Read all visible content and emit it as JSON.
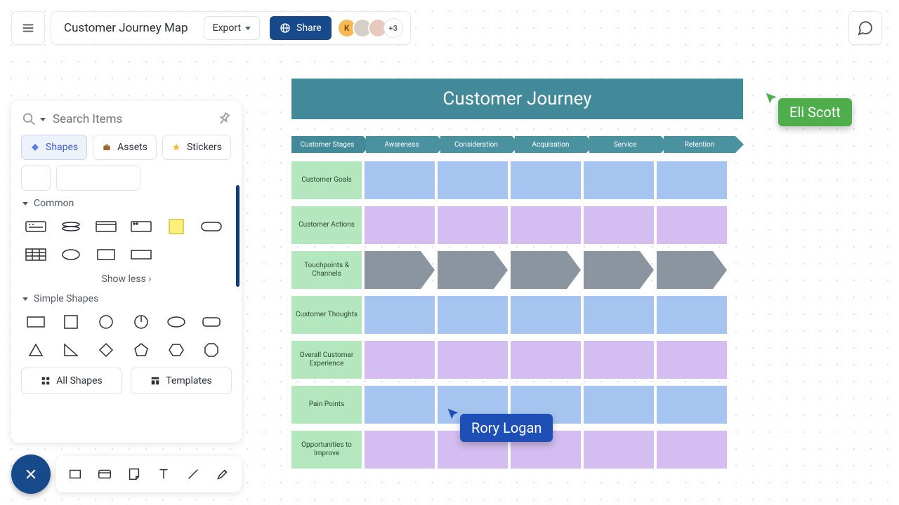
{
  "toolbar": {
    "doc_title": "Customer Journey Map",
    "export_label": "Export",
    "share_label": "Share",
    "avatar_more": "+3"
  },
  "panel": {
    "search_placeholder": "Search Items",
    "tabs": [
      "Shapes",
      "Assets",
      "Stickers"
    ],
    "section_common": "Common",
    "section_simple": "Simple Shapes",
    "show_less": "Show less",
    "all_shapes": "All Shapes",
    "templates": "Templates"
  },
  "canvas": {
    "title": "Customer Journey",
    "stages": [
      "Customer Stages",
      "Awareness",
      "Consideration",
      "Acquisation",
      "Service",
      "Retention"
    ],
    "rows": [
      {
        "label": "Customer Goals",
        "style": "blue"
      },
      {
        "label": "Customer Actions",
        "style": "purple"
      },
      {
        "label": "Touchpoints & Channels",
        "style": "arrow"
      },
      {
        "label": "Customer Thoughts",
        "style": "blue"
      },
      {
        "label": "Overall Customer Experience",
        "style": "purple"
      },
      {
        "label": "Pain Points",
        "style": "blue"
      },
      {
        "label": "Opportunities to Improve",
        "style": "purple"
      }
    ]
  },
  "cursors": {
    "eli": "Eli Scott",
    "rory": "Rory Logan"
  }
}
